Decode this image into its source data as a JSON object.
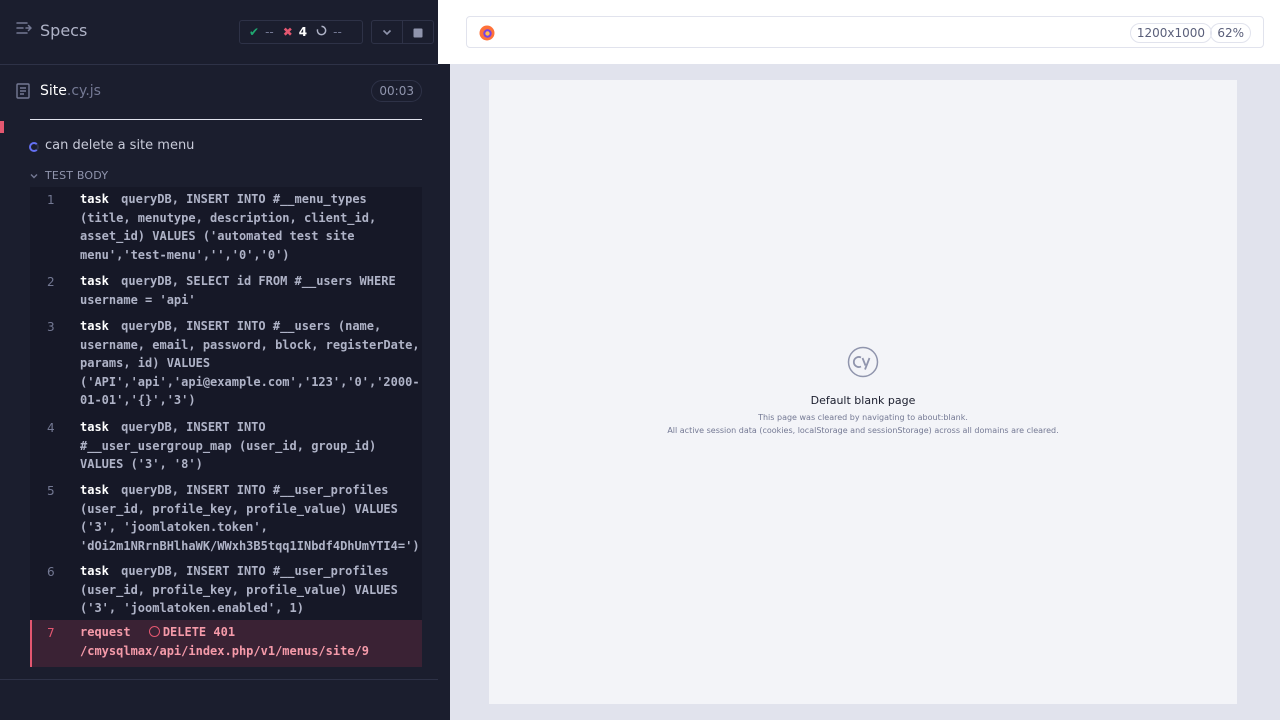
{
  "reporter": {
    "header": {
      "specs_label": "Specs",
      "stats": {
        "passed": "--",
        "failed": "4",
        "pending": "--"
      }
    },
    "spec": {
      "name": "Site",
      "ext": ".cy.js",
      "duration": "00:03"
    },
    "test": {
      "title": "can delete a site menu",
      "body_label": "TEST BODY",
      "commands": [
        {
          "num": "1",
          "name": "task",
          "message": "queryDB, INSERT INTO #__menu_types (title, menutype, description, client_id, asset_id) VALUES ('automated test site menu','test-menu','','0','0')"
        },
        {
          "num": "2",
          "name": "task",
          "message": "queryDB, SELECT id FROM #__users WHERE username = 'api'"
        },
        {
          "num": "3",
          "name": "task",
          "message": "queryDB, INSERT INTO #__users (name, username, email, password, block, registerDate, params, id) VALUES ('API','api','api@example.com','123','0','2000-01-01','{}','3')"
        },
        {
          "num": "4",
          "name": "task",
          "message": "queryDB, INSERT INTO #__user_usergroup_map (user_id, group_id) VALUES ('3', '8')"
        },
        {
          "num": "5",
          "name": "task",
          "message": "queryDB, INSERT INTO #__user_profiles (user_id, profile_key, profile_value) VALUES ('3', 'joomlatoken.token', 'dOi2m1NRrnBHlhaWK/WWxh3B5tqq1INbdf4DhUmYTI4=')"
        },
        {
          "num": "6",
          "name": "task",
          "message": "queryDB, INSERT INTO #__user_profiles (user_id, profile_key, profile_value) VALUES ('3', 'joomlatoken.enabled', 1)"
        },
        {
          "num": "7",
          "name": "request",
          "message": "DELETE 401 /cmysqlmax/api/index.php/v1/menus/site/9"
        }
      ]
    }
  },
  "aut": {
    "browser_icon": "firefox-icon",
    "viewport": "1200x1000",
    "zoom": "62%",
    "blank_page": {
      "title": "Default blank page",
      "line1": "This page was cleared by navigating to about:blank.",
      "line2": "All active session data (cookies, localStorage and sessionStorage) across all domains are cleared."
    }
  },
  "colors": {
    "reporter_bg": "#1b1e2e",
    "passed": "#1fa971",
    "failed": "#e45770",
    "running": "#6470f3"
  }
}
